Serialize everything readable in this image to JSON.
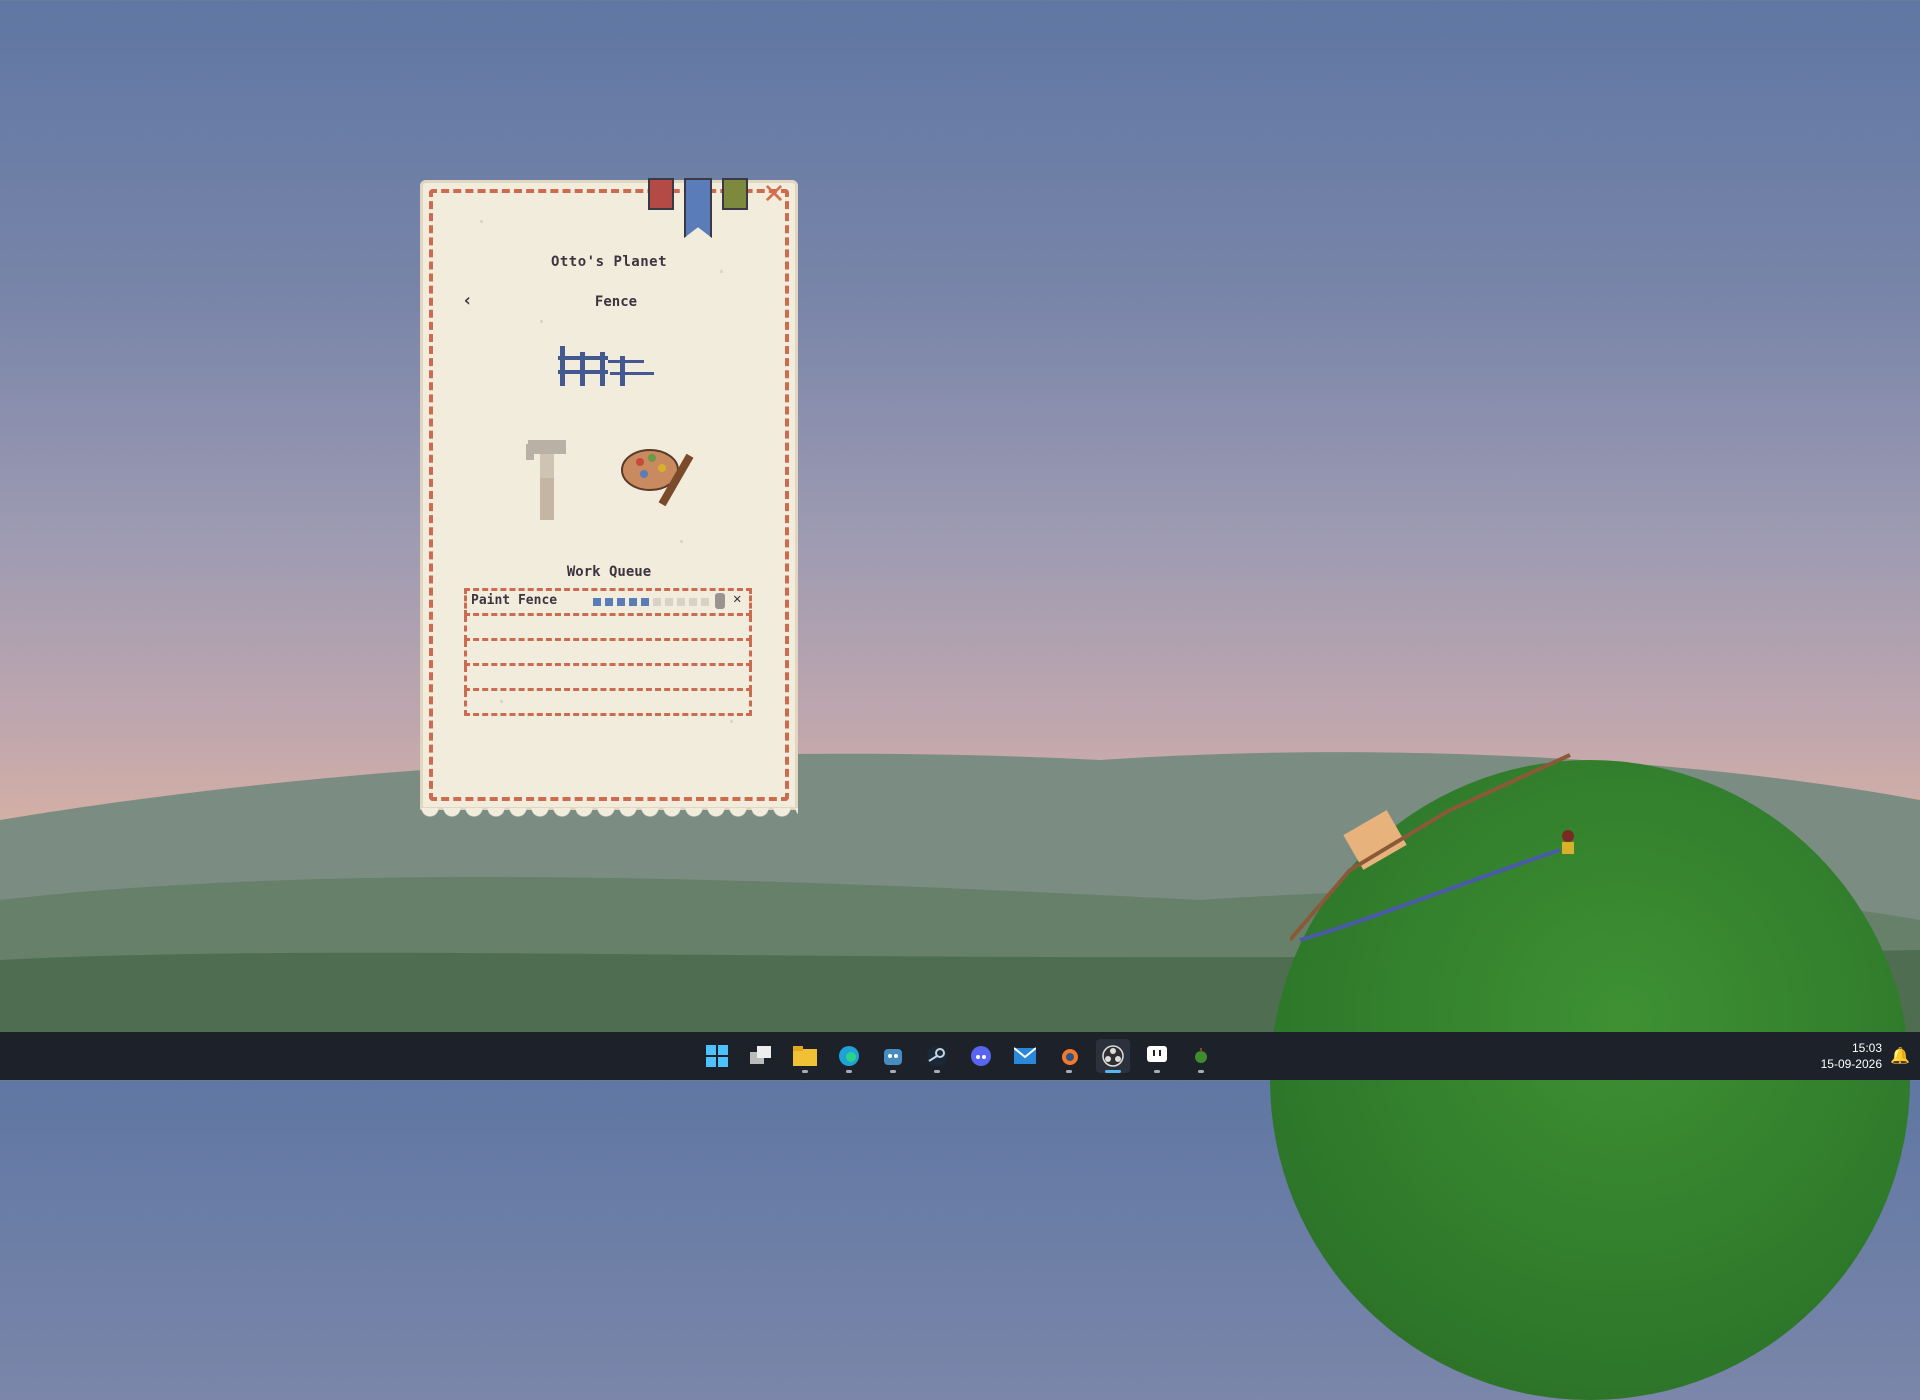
{
  "window": {
    "title": "Otto's Planet",
    "subtitle": "Fence",
    "back_glyph": "‹",
    "close_glyph": "✕"
  },
  "tabs": [
    {
      "name": "red-tab",
      "color": "#b34a45"
    },
    {
      "name": "blue-bookmark-tab",
      "color": "#5a7cb8"
    },
    {
      "name": "green-tab",
      "color": "#7d8a3e"
    }
  ],
  "tools": [
    "hammer-icon",
    "paint-palette-icon"
  ],
  "work_queue": {
    "title": "Work Queue",
    "items": [
      {
        "label": "Paint Fence",
        "progress_steps_done": 5,
        "progress_steps_total": 10,
        "remove_glyph": "✕"
      }
    ],
    "empty_slots": 4
  },
  "taskbar": {
    "apps": [
      "windows-start-icon",
      "task-view-icon",
      "file-explorer-icon",
      "edge-icon",
      "godot-icon",
      "steam-icon",
      "discord-icon",
      "mail-icon",
      "blender-icon",
      "obs-icon",
      "twitch-like-icon",
      "game-icon"
    ],
    "time": "15:03",
    "date": "15-09-2026"
  }
}
